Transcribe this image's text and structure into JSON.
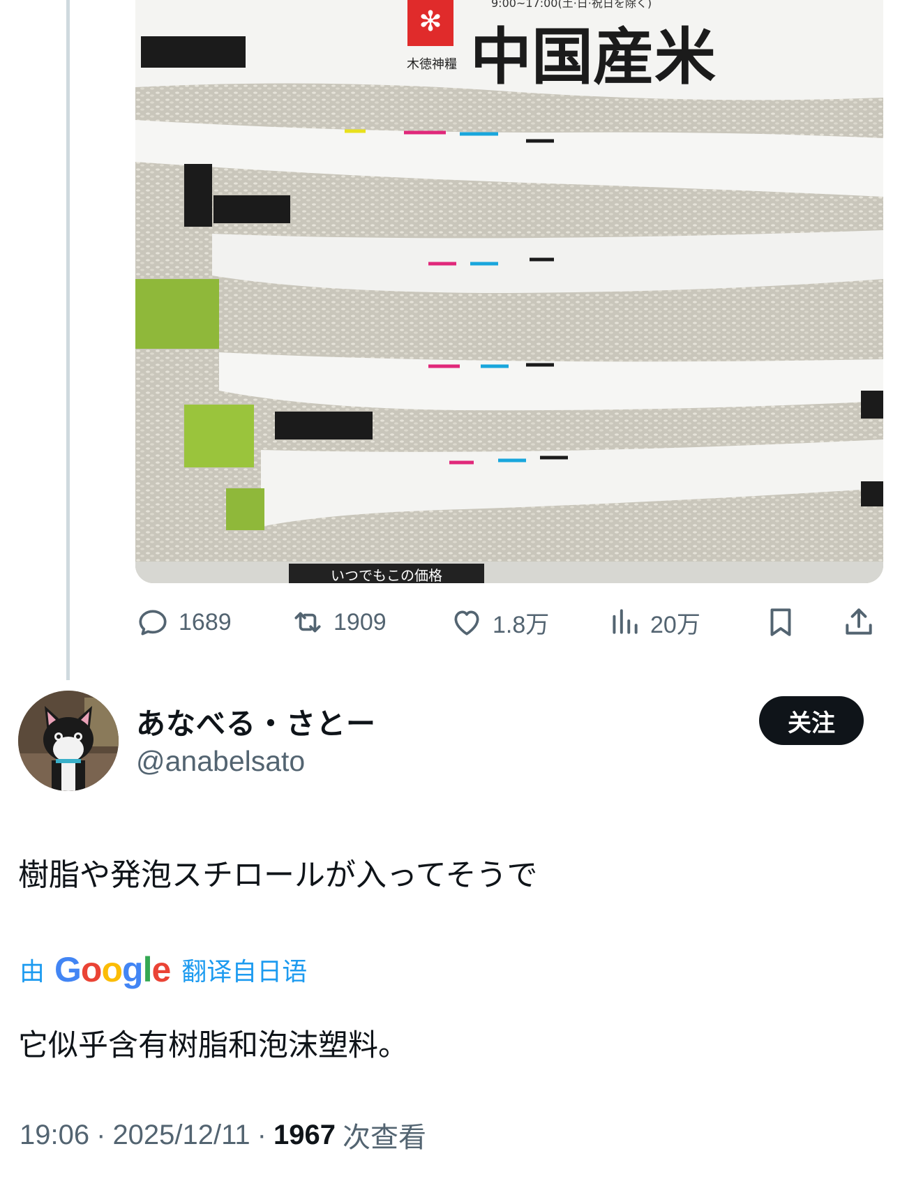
{
  "photo": {
    "product_name": "中国産米",
    "brand": "木徳神糧",
    "hours_text": "9:00~17:00(土·日·祝日を除く)",
    "shelf_label": "いつでもこの価格"
  },
  "actions": {
    "replies": "1689",
    "retweets": "1909",
    "likes": "1.8万",
    "views": "20万"
  },
  "author": {
    "display_name": "あなべる・さとー",
    "handle": "@anabelsato",
    "follow_label": "关注"
  },
  "tweet": {
    "text": "樹脂や発泡スチロールが入ってそうで"
  },
  "translation": {
    "by_label": "由",
    "provider": "Google",
    "from_label": "翻译自日语",
    "text": "它似乎含有树脂和泡沫塑料。"
  },
  "meta": {
    "time": "19:06",
    "date": "2025/12/11",
    "view_count": "1967",
    "views_label": "次查看"
  },
  "colors": {
    "accent": "#1d9bf0",
    "text_primary": "#0f1419",
    "text_secondary": "#536471",
    "follow_bg": "#0f1419"
  }
}
